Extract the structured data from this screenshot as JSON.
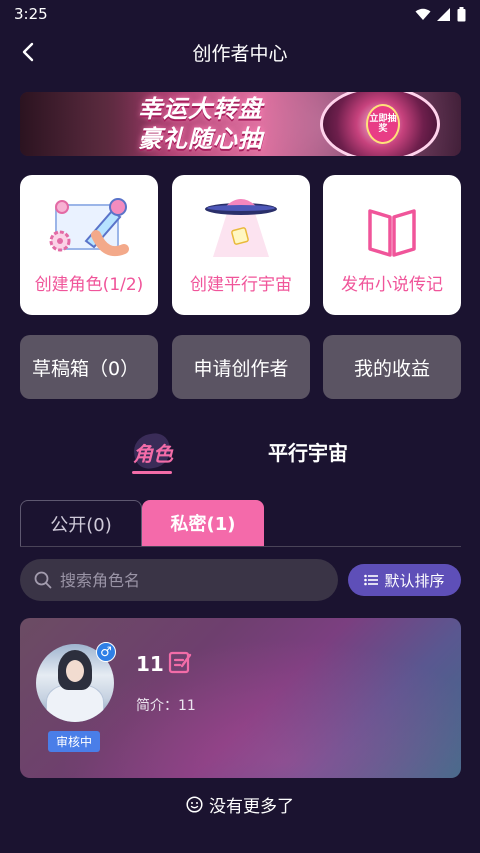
{
  "status_bar": {
    "time": "3:25"
  },
  "header": {
    "title": "创作者中心"
  },
  "banner": {
    "line1": "幸运大转盘",
    "line2": "豪礼随心抽",
    "wheel_button": "立即抽奖"
  },
  "cards": [
    {
      "label": "创建角色(1/2)"
    },
    {
      "label": "创建平行宇宙"
    },
    {
      "label": "发布小说传记"
    }
  ],
  "buttons": {
    "drafts": "草稿箱（0）",
    "apply_creator": "申请创作者",
    "my_earnings": "我的收益"
  },
  "tabs": {
    "role": "角色",
    "universe": "平行宇宙"
  },
  "segment": {
    "public": "公开(0)",
    "private": "私密(1)"
  },
  "search": {
    "placeholder": "搜索角色名"
  },
  "sort": {
    "label": "默认排序"
  },
  "character": {
    "name": "11",
    "description": "简介：11",
    "status": "审核中",
    "gender_symbol": "♂"
  },
  "footer": {
    "no_more": "没有更多了"
  },
  "colors": {
    "accent": "#f46aaa",
    "background": "#1b1330",
    "sort_button": "#5e4fb8"
  }
}
